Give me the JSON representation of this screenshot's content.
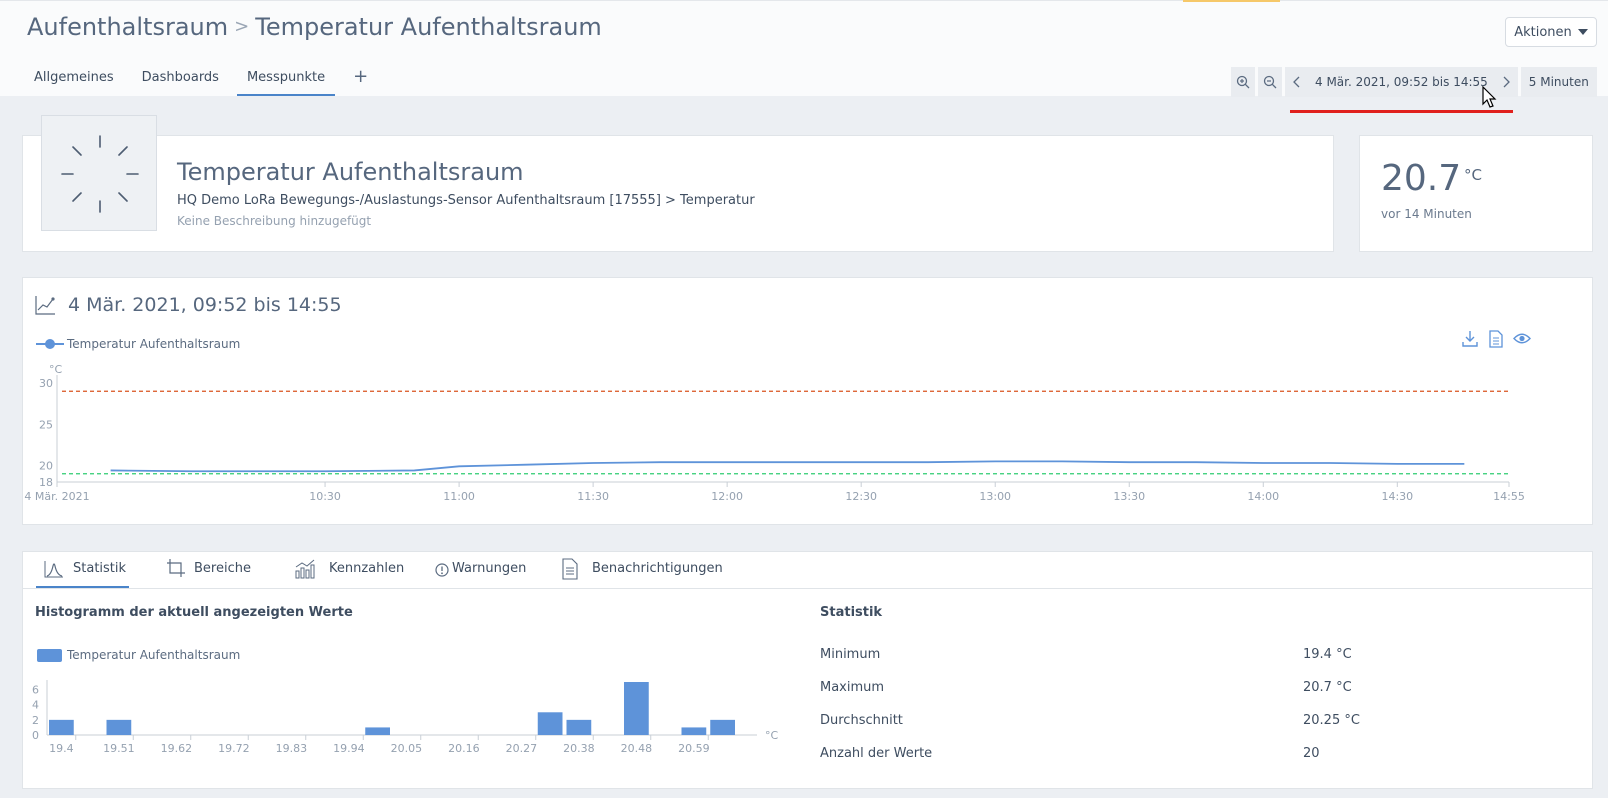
{
  "header": {
    "breadcrumb_parent": "Aufenthaltsraum",
    "breadcrumb_separator": ">",
    "breadcrumb_current": "Temperatur Aufenthaltsraum",
    "actions_label": "Aktionen"
  },
  "tabs": [
    {
      "label": "Allgemeines"
    },
    {
      "label": "Dashboards"
    },
    {
      "label": "Messpunkte"
    },
    {
      "label": "+"
    }
  ],
  "timebar": {
    "range_label": "4 Mär. 2021, 09:52 bis 14:55",
    "interval_label": "5 Minuten"
  },
  "info": {
    "title": "Temperatur Aufenthaltsraum",
    "path": "HQ Demo LoRa Bewegungs-/Auslastungs-Sensor Aufenthaltsraum [17555] > Temperatur",
    "description": "Keine Beschreibung hinzugefügt"
  },
  "current": {
    "value": "20.7",
    "unit": "°C",
    "ago": "vor 14 Minuten"
  },
  "chart_card": {
    "title": "4 Mär. 2021, 09:52 bis 14:55",
    "legend_label": "Temperatur Aufenthaltsraum"
  },
  "bottom_tabs": [
    {
      "label": "Statistik"
    },
    {
      "label": "Bereiche"
    },
    {
      "label": "Kennzahlen"
    },
    {
      "label": "Warnungen"
    },
    {
      "label": "Benachrichtigungen"
    }
  ],
  "histogram": {
    "title": "Histogramm der aktuell angezeigten Werte",
    "legend_label": "Temperatur Aufenthaltsraum"
  },
  "statistics": {
    "title": "Statistik",
    "rows": [
      {
        "label": "Minimum",
        "value": "19.4 °C"
      },
      {
        "label": "Maximum",
        "value": "20.7 °C"
      },
      {
        "label": "Durchschnitt",
        "value": "20.25 °C"
      },
      {
        "label": "Anzahl der Werte",
        "value": "20"
      }
    ]
  },
  "colors": {
    "series": "#5e93d9",
    "upper_threshold": "#d9531e",
    "lower_threshold": "#2ecc71",
    "accent": "#4a84c9"
  },
  "chart_data": [
    {
      "type": "line",
      "ylabel": "°C",
      "ylim": [
        18,
        30
      ],
      "yticks": [
        18,
        20,
        25,
        30
      ],
      "x_ticks": [
        "4 Mär. 2021",
        "10:30",
        "11:00",
        "11:30",
        "12:00",
        "12:30",
        "13:00",
        "13:30",
        "14:00",
        "14:30",
        "14:55"
      ],
      "x_tick_minutes": [
        570,
        630,
        660,
        690,
        720,
        750,
        780,
        810,
        840,
        870,
        895
      ],
      "xlim_minutes": [
        570,
        895
      ],
      "grid": false,
      "series": [
        {
          "name": "Temperatur Aufenthaltsraum",
          "x_minutes": [
            582,
            600,
            615,
            630,
            650,
            660,
            675,
            690,
            705,
            720,
            735,
            750,
            765,
            780,
            795,
            810,
            825,
            840,
            855,
            870,
            885
          ],
          "values": [
            19.4,
            19.3,
            19.3,
            19.3,
            19.4,
            19.9,
            20.1,
            20.3,
            20.4,
            20.4,
            20.4,
            20.4,
            20.4,
            20.5,
            20.5,
            20.4,
            20.4,
            20.3,
            20.3,
            20.2,
            20.2
          ]
        }
      ],
      "thresholds": [
        29,
        19
      ]
    },
    {
      "type": "bar",
      "xlabel": "°C",
      "categories": [
        "19.4",
        "19.51",
        "19.62",
        "19.72",
        "19.83",
        "19.94",
        "20.05",
        "20.16",
        "20.27",
        "20.38",
        "20.48",
        "20.59"
      ],
      "bins": [
        19.4,
        19.45,
        19.51,
        19.56,
        19.62,
        19.67,
        19.72,
        19.78,
        19.83,
        19.89,
        19.94,
        20.0,
        20.05,
        20.11,
        20.16,
        20.22,
        20.27,
        20.33,
        20.38,
        20.43,
        20.48,
        20.54,
        20.59,
        20.64
      ],
      "values": [
        2,
        0,
        2,
        0,
        0,
        0,
        0,
        0,
        0,
        0,
        0,
        1,
        0,
        0,
        0,
        0,
        0,
        3,
        2,
        0,
        7,
        0,
        1,
        2
      ],
      "yticks": [
        0,
        2,
        4,
        6
      ],
      "ylim": [
        0,
        7
      ]
    }
  ]
}
